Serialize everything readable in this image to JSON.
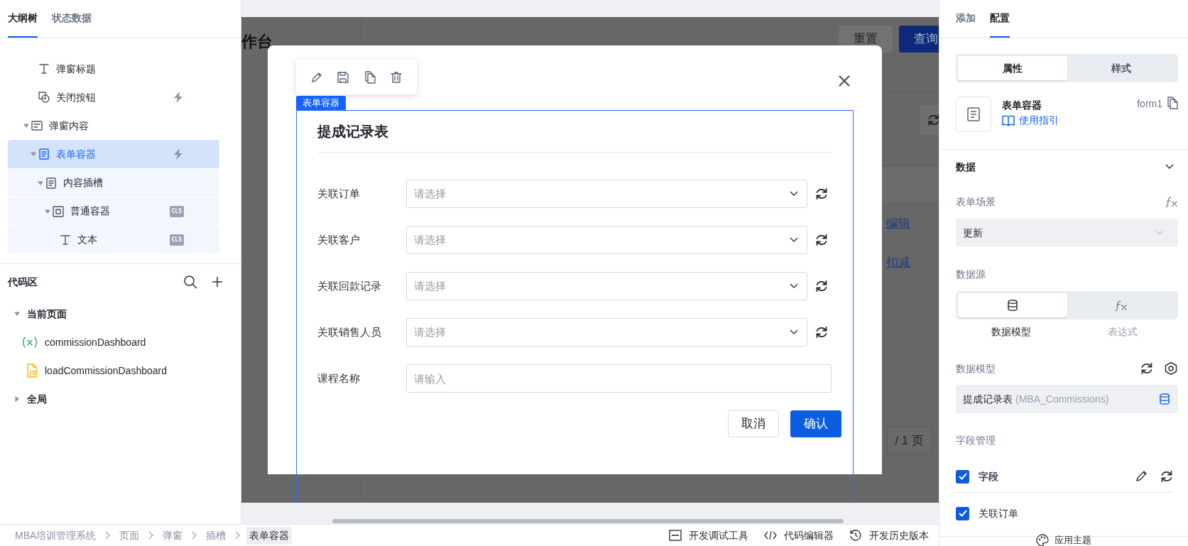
{
  "outline_panel": {
    "tabs": [
      {
        "label": "大纲树",
        "selected": true
      },
      {
        "label": "状态数据",
        "selected": false
      }
    ],
    "tree": [
      {
        "children": [
          {
            "label": "弹窗标题",
            "kind": "text",
            "selected": false
          },
          {
            "label": "关闭按钮",
            "kind": "button",
            "selected": false,
            "event": true
          }
        ]
      },
      {
        "label": "弹窗内容",
        "kind": "panel",
        "selected": false,
        "expanded": true,
        "children": [
          {
            "label": "表单容器",
            "kind": "form",
            "selected": true,
            "expanded": true,
            "event": true,
            "children": [
              {
                "label": "内容插槽",
                "kind": "form",
                "selected": false,
                "expanded": true,
                "children": [
                  {
                    "label": "普通容器",
                    "kind": "box",
                    "selected": false,
                    "expanded": true,
                    "tag": "CLS",
                    "children": [
                      {
                        "label": "文本",
                        "kind": "text",
                        "selected": false,
                        "tag": "CLS"
                      }
                    ]
                  }
                ]
              }
            ]
          }
        ]
      }
    ]
  },
  "code_area": {
    "title": "代码区",
    "groups": [
      {
        "label": "当前页面",
        "expanded": true,
        "items": [
          {
            "label": "commissionDashboard",
            "kind": "variable"
          },
          {
            "label": "loadCommissionDashboard",
            "kind": "script"
          }
        ]
      },
      {
        "label": "全局",
        "expanded": false
      }
    ]
  },
  "background_page": {
    "title": "作台",
    "buttons": [
      {
        "label": "重置",
        "kind": "default"
      },
      {
        "label": "查询",
        "kind": "primary"
      }
    ],
    "rows": [
      {
        "action": "编辑"
      },
      {
        "action": "扣减"
      }
    ],
    "pagination": "/ 1 页"
  },
  "modal": {
    "selection_tag": "表单容器",
    "form_title": "提成记录表",
    "fields": [
      {
        "label": "关联订单",
        "kind": "select",
        "placeholder": "请选择"
      },
      {
        "label": "关联客户",
        "kind": "select",
        "placeholder": "请选择"
      },
      {
        "label": "关联回款记录",
        "kind": "select",
        "placeholder": "请选择"
      },
      {
        "label": "关联销售人员",
        "kind": "select",
        "placeholder": "请选择"
      },
      {
        "label": "课程名称",
        "kind": "input",
        "placeholder": "请输入"
      }
    ],
    "buttons": [
      {
        "label": "取消",
        "kind": "default"
      },
      {
        "label": "确认",
        "kind": "primary"
      }
    ]
  },
  "breadcrumb": [
    {
      "label": "MBA培训管理系统",
      "selected": false
    },
    {
      "label": "页面",
      "selected": false
    },
    {
      "label": "弹窗",
      "selected": false
    },
    {
      "label": "插槽",
      "selected": false
    },
    {
      "label": "表单容器",
      "selected": true
    }
  ],
  "dev_tools": [
    {
      "label": "开发调试工具",
      "kind": "debug"
    },
    {
      "label": "代码编辑器",
      "kind": "code"
    },
    {
      "label": "开发历史版本",
      "kind": "history"
    }
  ],
  "config_panel": {
    "tabs": [
      {
        "label": "添加",
        "selected": false
      },
      {
        "label": "配置",
        "selected": true
      }
    ],
    "mode_tabs": [
      {
        "label": "属性",
        "selected": true
      },
      {
        "label": "样式",
        "selected": false
      }
    ],
    "component": {
      "name": "表单容器",
      "guide_link": "使用指引",
      "id": "form1"
    },
    "section": {
      "title": "数据",
      "expanded": true
    },
    "scene": {
      "label": "表单场景",
      "value": "更新",
      "disabled": true
    },
    "source": {
      "label": "数据源",
      "options": [
        {
          "label": "数据模型",
          "kind": "model",
          "selected": true
        },
        {
          "label": "表达式",
          "kind": "expression",
          "selected": false
        }
      ]
    },
    "model": {
      "label": "数据模型",
      "value": "提成记录表",
      "hint": "(MBA_Commissions)"
    },
    "fields": {
      "label": "字段管理",
      "items": [
        {
          "label": "字段",
          "kind": "header",
          "checked": true
        },
        {
          "label": "关联订单",
          "kind": "field",
          "checked": true
        }
      ]
    },
    "theme_button": "应用主题"
  }
}
